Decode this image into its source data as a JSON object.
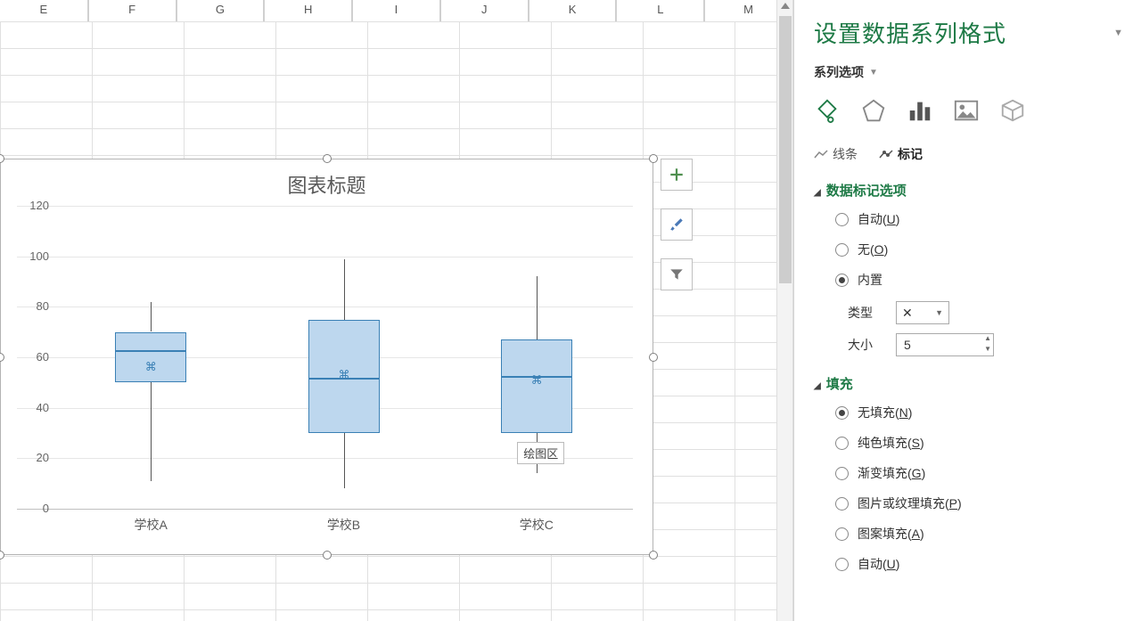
{
  "columns": [
    "E",
    "F",
    "G",
    "H",
    "I",
    "J",
    "K",
    "L",
    "M"
  ],
  "chart_data": {
    "type": "boxplot",
    "title": "图表标题",
    "ylim": [
      0,
      120
    ],
    "yticks": [
      0,
      20,
      40,
      60,
      80,
      100,
      120
    ],
    "categories": [
      "学校A",
      "学校B",
      "学校C"
    ],
    "series": [
      {
        "name": "学校A",
        "min": 11,
        "q1": 50,
        "median": 63,
        "q3": 70,
        "max": 82,
        "mean": 56
      },
      {
        "name": "学校B",
        "min": 8,
        "q1": 30,
        "median": 52,
        "q3": 75,
        "max": 99,
        "mean": 53
      },
      {
        "name": "学校C",
        "min": 14,
        "q1": 30,
        "median": 55,
        "q3": 67,
        "max": 92,
        "mean": 51
      }
    ],
    "tooltip": "绘图区"
  },
  "side_buttons": {
    "add": "plus-icon",
    "brush": "brush-icon",
    "filter": "filter-icon"
  },
  "pane": {
    "title": "设置数据系列格式",
    "subhead": "系列选项",
    "tabs": {
      "line": "线条",
      "marker": "标记"
    },
    "section1": {
      "title": "数据标记选项",
      "opt_auto": "自动",
      "opt_auto_k": "U",
      "opt_none": "无",
      "opt_none_k": "O",
      "opt_builtin": "内置",
      "type_label": "类型",
      "type_value": "✕",
      "size_label": "大小",
      "size_value": "5"
    },
    "section2": {
      "title": "填充",
      "opt_nofill": "无填充",
      "opt_nofill_k": "N",
      "opt_solid": "纯色填充",
      "opt_solid_k": "S",
      "opt_grad": "渐变填充",
      "opt_grad_k": "G",
      "opt_pic": "图片或纹理填充",
      "opt_pic_k": "P",
      "opt_pattern": "图案填充",
      "opt_pattern_k": "A",
      "opt_auto": "自动",
      "opt_auto_k": "U"
    }
  }
}
